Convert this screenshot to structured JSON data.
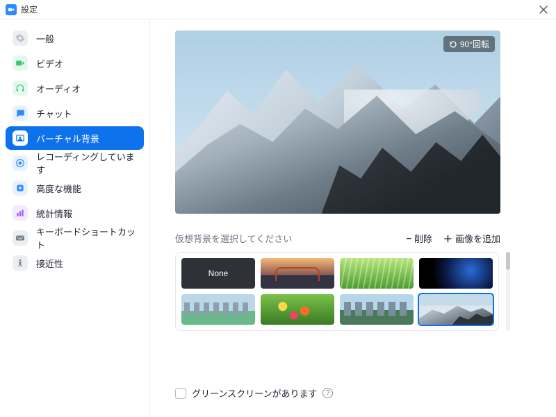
{
  "window": {
    "title": "設定"
  },
  "sidebar": {
    "items": [
      {
        "label": "一般",
        "icon": "gear-icon",
        "bg": "#eceef2"
      },
      {
        "label": "ビデオ",
        "icon": "video-icon",
        "bg": "#eceef2"
      },
      {
        "label": "オーディオ",
        "icon": "headphones-icon",
        "bg": "#eceef2"
      },
      {
        "label": "チャット",
        "icon": "chat-icon",
        "bg": "#eceef2"
      },
      {
        "label": "バーチャル背景",
        "icon": "virtual-background-icon",
        "bg": "#0E72ED",
        "selected": true
      },
      {
        "label": "レコーディングしています",
        "icon": "recording-icon",
        "bg": "#eceef2"
      },
      {
        "label": "高度な機能",
        "icon": "advanced-icon",
        "bg": "#eceef2"
      },
      {
        "label": "統計情報",
        "icon": "statistics-icon",
        "bg": "#eceef2"
      },
      {
        "label": "キーボードショートカット",
        "icon": "keyboard-icon",
        "bg": "#eceef2"
      },
      {
        "label": "接近性",
        "icon": "accessibility-icon",
        "bg": "#eceef2"
      }
    ]
  },
  "preview": {
    "rotate_label": "90°回転"
  },
  "backgrounds": {
    "choose_label": "仮想背景を選択してください",
    "delete_label": "削除",
    "add_label": "画像を追加",
    "none_label": "None",
    "selected_index": 7
  },
  "greenscreen": {
    "label": "グリーンスクリーンがあります",
    "checked": false
  },
  "nav_icon_colors": {
    "gear": "#b7bcc6",
    "video": "#38c772",
    "headphones": "#38c772",
    "chat": "#2D8CFF",
    "vbg": "#ffffff",
    "recording": "#2D8CFF",
    "advanced": "#2D8CFF",
    "stats": "#a259ff",
    "keyboard": "#6e7680",
    "access": "#6e7680"
  }
}
